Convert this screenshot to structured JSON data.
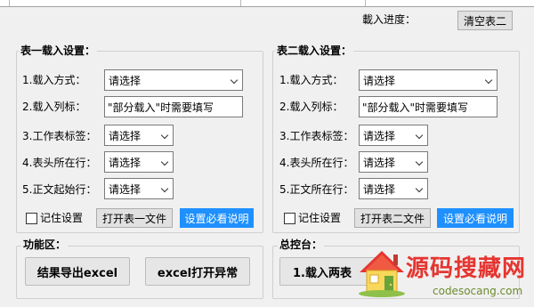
{
  "top": {
    "progress_label": "載入进度：",
    "clear_table2_button": "清空表二"
  },
  "table1": {
    "title": "表一载入设置：",
    "load_mode_label": "1.载入方式：",
    "load_mode_value": "请选择",
    "load_columns_label": "2.载入列标：",
    "load_columns_value": "\"部分载入\"时需要填写",
    "sheet_tag_label": "3.工作表标签：",
    "sheet_tag_value": "请选择",
    "header_row_label": "4.表头所在行：",
    "header_row_value": "请选择",
    "body_start_label": "5.正文起始行：",
    "body_start_value": "请选择",
    "remember_label": "记住设置",
    "open_file_button": "打开表一文件",
    "help_button": "设置必看说明"
  },
  "table2": {
    "title": "表二载入设置：",
    "load_mode_label": "1.载入方式：",
    "load_mode_value": "请选择",
    "load_columns_label": "2.载入列标：",
    "load_columns_value": "\"部分载入\"时需要填写",
    "sheet_tag_label": "3.工作表标签：",
    "sheet_tag_value": "请选择",
    "header_row_label": "4.表头所在行：",
    "header_row_value": "请选择",
    "body_row_label": "5.正文所在行：",
    "body_row_value": "请选择",
    "remember_label": "记住设置",
    "open_file_button": "打开表二文件",
    "help_button": "设置必看说明"
  },
  "functions": {
    "title": "功能区：",
    "export_button": "结果导出excel",
    "excel_error_button": "excel打开异常"
  },
  "console": {
    "title": "总控台：",
    "load_both_button": "1.载入两表"
  },
  "watermark": {
    "name": "源码搜藏网",
    "url": "codesocang.com"
  },
  "colors": {
    "accent_button": "#1e90ff",
    "watermark_red": "#e53530"
  }
}
